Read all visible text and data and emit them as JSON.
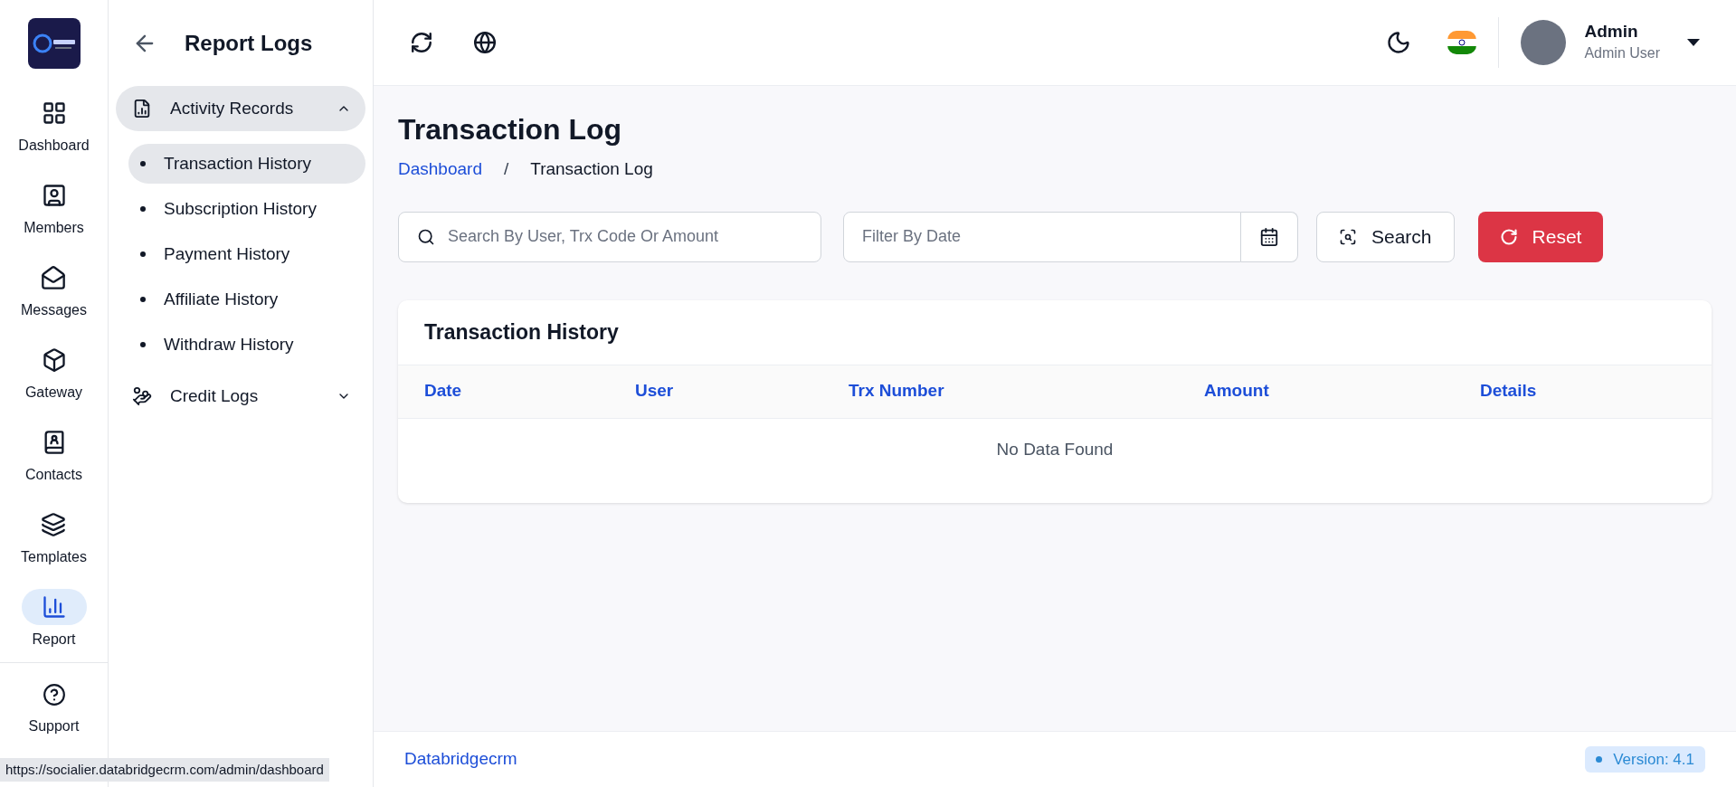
{
  "nav": [
    {
      "label": "Dashboard",
      "selected": false
    },
    {
      "label": "Members",
      "selected": false
    },
    {
      "label": "Messages",
      "selected": false
    },
    {
      "label": "Gateway",
      "selected": false
    },
    {
      "label": "Contacts",
      "selected": false
    },
    {
      "label": "Templates",
      "selected": false
    },
    {
      "label": "Report",
      "selected": true
    }
  ],
  "nav_bottom": {
    "label": "Support"
  },
  "submenu": {
    "title": "Report Logs",
    "groups": [
      {
        "label": "Activity Records",
        "expanded": true,
        "children": [
          {
            "label": "Transaction History",
            "selected": true
          },
          {
            "label": "Subscription History",
            "selected": false
          },
          {
            "label": "Payment History",
            "selected": false
          },
          {
            "label": "Affiliate History",
            "selected": false
          },
          {
            "label": "Withdraw History",
            "selected": false
          }
        ]
      },
      {
        "label": "Credit Logs",
        "expanded": false
      }
    ]
  },
  "user": {
    "name": "Admin",
    "role": "Admin User"
  },
  "page": {
    "title": "Transaction Log",
    "breadcrumb": [
      "Dashboard",
      "Transaction Log"
    ],
    "breadcrumb_separator": "/"
  },
  "filters": {
    "search_placeholder": "Search By User, Trx Code Or Amount",
    "date_placeholder": "Filter By Date",
    "search_button": "Search",
    "reset_button": "Reset"
  },
  "table": {
    "title": "Transaction History",
    "columns": [
      "Date",
      "User",
      "Trx Number",
      "Amount",
      "Details"
    ],
    "empty": "No Data Found"
  },
  "footer": {
    "brand": "Databridgecrm",
    "version": "Version: 4.1"
  },
  "status_url": "https://socialier.databridgecrm.com/admin/dashboard"
}
